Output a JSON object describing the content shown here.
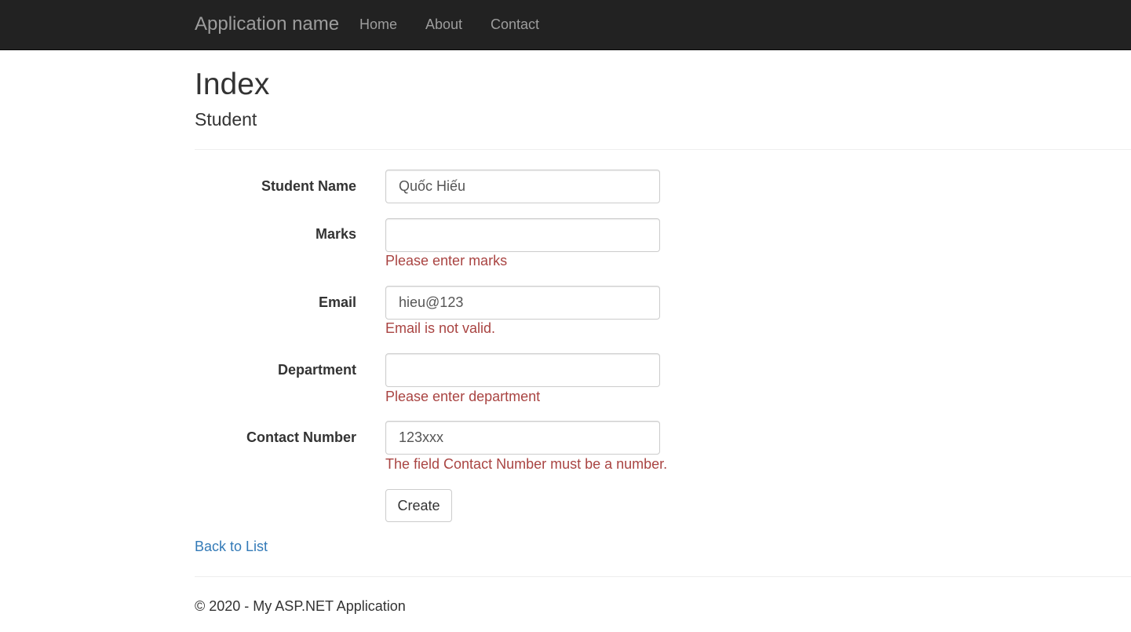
{
  "navbar": {
    "brand": "Application name",
    "links": [
      "Home",
      "About",
      "Contact"
    ]
  },
  "page": {
    "title": "Index",
    "subtitle": "Student"
  },
  "form": {
    "fields": [
      {
        "label": "Student Name",
        "value": "Quốc Hiếu",
        "error": ""
      },
      {
        "label": "Marks",
        "value": "",
        "error": "Please enter marks"
      },
      {
        "label": "Email",
        "value": "hieu@123",
        "error": "Email is not valid."
      },
      {
        "label": "Department",
        "value": "",
        "error": "Please enter department"
      },
      {
        "label": "Contact Number",
        "value": "123xxx",
        "error": "The field Contact Number must be a number."
      }
    ],
    "submit_label": "Create"
  },
  "back_link": "Back to List",
  "footer": {
    "copyright": "© 2020 - My ASP.NET Application"
  },
  "colors": {
    "navbar_bg": "#222222",
    "nav_text": "#9d9d9d",
    "error_text": "#a94442",
    "link": "#337ab7"
  }
}
